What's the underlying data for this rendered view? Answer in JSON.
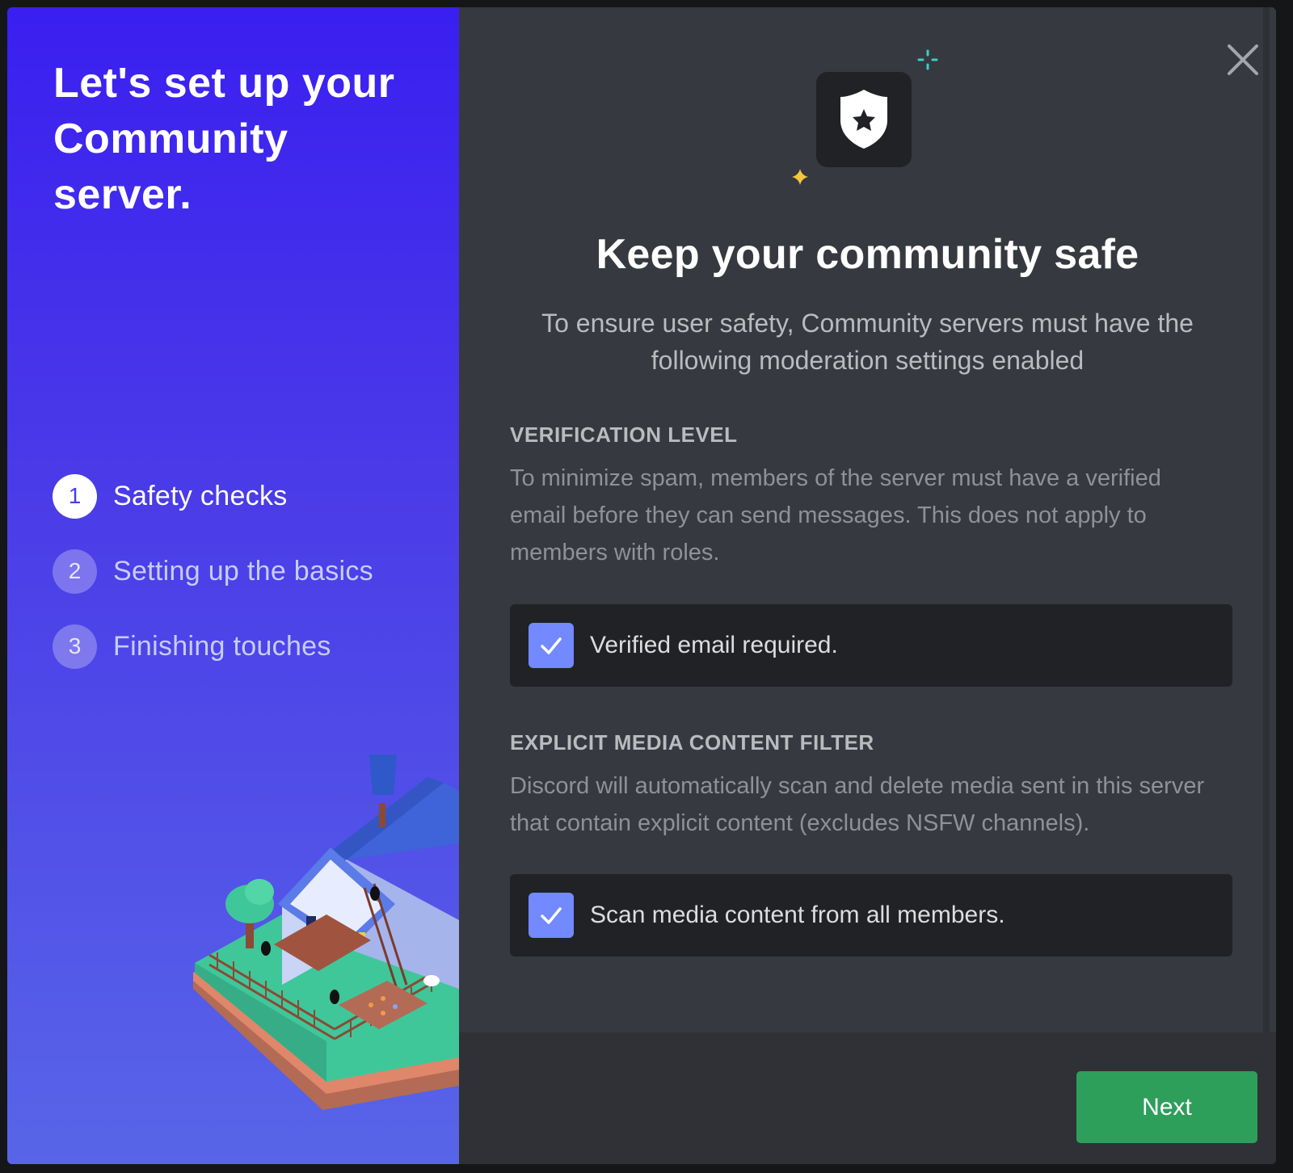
{
  "sidebar": {
    "title": "Let's set up your Community server.",
    "steps": [
      {
        "number": "1",
        "label": "Safety checks",
        "state": "active"
      },
      {
        "number": "2",
        "label": "Setting up the basics",
        "state": "inactive"
      },
      {
        "number": "3",
        "label": "Finishing touches",
        "state": "inactive"
      }
    ]
  },
  "main": {
    "title": "Keep your community safe",
    "subtitle": "To ensure user safety, Community servers must have the following moderation settings enabled",
    "verification": {
      "label": "VERIFICATION LEVEL",
      "description": "To minimize spam, members of the server must have a verified email before they can send messages. This does not apply to members with roles.",
      "checkbox_label": "Verified email required.",
      "checked": true
    },
    "media_filter": {
      "label": "EXPLICIT MEDIA CONTENT FILTER",
      "description": "Discord will automatically scan and delete media sent in this server that contain explicit content (excludes NSFW channels).",
      "checkbox_label": "Scan media content from all members.",
      "checked": true
    }
  },
  "footer": {
    "next_label": "Next"
  },
  "icons": {
    "close": "close-icon",
    "shield": "shield-star-icon",
    "check": "checkmark-icon"
  },
  "colors": {
    "accent": "#7289ff",
    "next_button": "#2e9e5b",
    "sidebar_top": "#3a1ff0",
    "sidebar_bottom": "#5865e8",
    "panel_bg": "#36393f"
  }
}
